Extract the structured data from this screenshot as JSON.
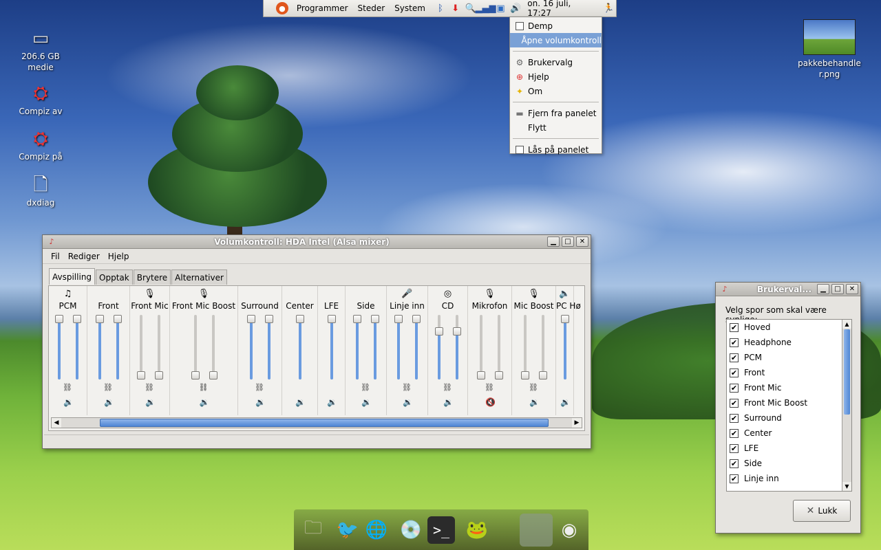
{
  "top_panel": {
    "menus": [
      "Programmer",
      "Steder",
      "System"
    ],
    "clock": "on. 16 juli, 17:27",
    "tray_icons": [
      "ubuntu-logo-icon",
      "bluetooth-icon",
      "download-icon",
      "search-icon",
      "network-signal-icon",
      "window-icon",
      "volume-icon",
      "running-man-icon"
    ]
  },
  "context_menu": {
    "items": [
      {
        "label": "Demp",
        "icon": "checkbox"
      },
      {
        "label": "Åpne volumkontroll",
        "icon": "none",
        "selected": true
      },
      {
        "label": "Brukervalg",
        "icon": "preferences-icon"
      },
      {
        "label": "Hjelp",
        "icon": "help-icon"
      },
      {
        "label": "Om",
        "icon": "about-icon"
      },
      {
        "label": "Fjern fra panelet",
        "icon": "remove-icon"
      },
      {
        "label": "Flytt",
        "icon": "none"
      },
      {
        "label": "Lås på panelet",
        "icon": "checkbox"
      }
    ]
  },
  "desktop_icons": [
    {
      "label": "206.6 GB medie",
      "icon": "drive-icon"
    },
    {
      "label": "Compiz av",
      "icon": "compiz-icon"
    },
    {
      "label": "Compiz på",
      "icon": "compiz-icon"
    },
    {
      "label": "dxdiag",
      "icon": "document-icon"
    },
    {
      "label": "pakkebehandler.png",
      "icon": "image-icon"
    }
  ],
  "volume_window": {
    "title": "Volumkontroll: HDA Intel (Alsa mixer)",
    "menus": [
      "Fil",
      "Rediger",
      "Hjelp"
    ],
    "tabs": [
      "Avspilling",
      "Opptak",
      "Brytere",
      "Alternativer"
    ],
    "active_tab": "Avspilling",
    "channels": [
      {
        "name": "PCM",
        "icon": "music-note-icon",
        "levels": [
          1.0,
          1.0
        ],
        "muted": false
      },
      {
        "name": "Front",
        "icon": "",
        "levels": [
          1.0,
          1.0
        ],
        "muted": false
      },
      {
        "name": "Front Mic",
        "icon": "microphone-icon",
        "levels": [
          0.0,
          0.0
        ],
        "muted": false
      },
      {
        "name": "Front Mic Boost",
        "icon": "microphone-icon",
        "levels": [
          0.0,
          0.0
        ],
        "muted": false
      },
      {
        "name": "Surround",
        "icon": "",
        "levels": [
          1.0,
          1.0
        ],
        "muted": false
      },
      {
        "name": "Center",
        "icon": "",
        "levels": [
          1.0
        ],
        "muted": false
      },
      {
        "name": "LFE",
        "icon": "",
        "levels": [
          1.0
        ],
        "muted": false
      },
      {
        "name": "Side",
        "icon": "",
        "levels": [
          1.0,
          1.0
        ],
        "muted": false
      },
      {
        "name": "Linje inn",
        "icon": "line-in-icon",
        "levels": [
          1.0,
          1.0
        ],
        "muted": false
      },
      {
        "name": "CD",
        "icon": "cd-icon",
        "levels": [
          0.78,
          0.78
        ],
        "muted": false
      },
      {
        "name": "Mikrofon",
        "icon": "microphone-icon",
        "levels": [
          0.0,
          0.0
        ],
        "muted": true
      },
      {
        "name": "Mic Boost",
        "icon": "microphone-icon",
        "levels": [
          0.0,
          0.0
        ],
        "muted": false
      },
      {
        "name": "PC Hø",
        "icon": "speaker-icon",
        "levels": [
          1.0
        ],
        "muted": false
      }
    ]
  },
  "preferences_window": {
    "title": "Brukerval...",
    "prompt": "Velg spor som skal være synlige:",
    "tracks": [
      {
        "label": "Hoved",
        "checked": true
      },
      {
        "label": "Headphone",
        "checked": true
      },
      {
        "label": "PCM",
        "checked": true
      },
      {
        "label": "Front",
        "checked": true
      },
      {
        "label": "Front Mic",
        "checked": true
      },
      {
        "label": "Front Mic Boost",
        "checked": true
      },
      {
        "label": "Surround",
        "checked": true
      },
      {
        "label": "Center",
        "checked": true
      },
      {
        "label": "LFE",
        "checked": true
      },
      {
        "label": "Side",
        "checked": true
      },
      {
        "label": "Linje inn",
        "checked": true
      }
    ],
    "close_label": "Lukk"
  },
  "dock": {
    "items": [
      "folder-icon",
      "pidgin-icon",
      "browser-globe-icon",
      "app-install-icon",
      "terminal-icon",
      "frog-icon",
      "map-icon",
      "volume-knob-icon"
    ]
  }
}
